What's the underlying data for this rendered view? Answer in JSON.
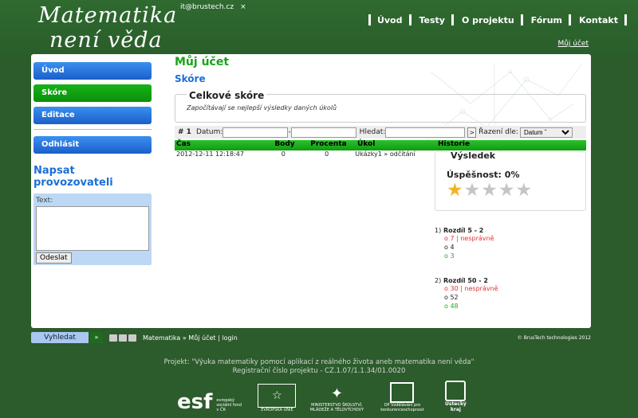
{
  "header": {
    "logo_line1": "Matematika",
    "logo_line2": "není věda",
    "email": "it@brustech.cz",
    "close": "×",
    "nav": [
      "Úvod",
      "Testy",
      "O projektu",
      "Fórum",
      "Kontakt"
    ],
    "my_account": "Můj účet"
  },
  "sidebar": {
    "items": [
      {
        "label": "Úvod",
        "active": false
      },
      {
        "label": "Skóre",
        "active": true
      },
      {
        "label": "Editace",
        "active": false
      }
    ],
    "logout": "Odhlásit",
    "feedback_title": "Napsat provozovateli",
    "text_label": "Text:",
    "send": "Odeslat"
  },
  "main": {
    "title": "Můj účet",
    "subtitle": "Skóre",
    "total_legend": "Celkové skóre",
    "total_note": "Započítávají se nejlepší výsledky daných úkolů",
    "filter": {
      "count": "# 1",
      "date_label": "Datum:",
      "dash": "-",
      "search_label": "Hledat:",
      "go": ">",
      "sort_label": "Řazení dle:",
      "sort_value": "Datum ˇ"
    },
    "columns": [
      "Čas",
      "Body",
      "Procenta",
      "Úkol",
      "Historie"
    ],
    "rows": [
      {
        "time": "2012-12-11 12:18:47",
        "points": "0",
        "percent": "0",
        "task": "Ukázky1 » odčítání"
      }
    ],
    "result": {
      "title": "Výsledek",
      "success": "Úspěšnost: 0%",
      "stars_total": 5,
      "stars_on": 1
    },
    "differences": [
      {
        "num": "1)",
        "title": "Rozdíl 5 - 2",
        "answers": [
          {
            "mark": "o",
            "text": "7",
            "suffix": " | nesprávně",
            "status": "wrong"
          },
          {
            "mark": "o",
            "text": "4",
            "suffix": "",
            "status": "neutral"
          },
          {
            "mark": "o",
            "text": "3",
            "suffix": "",
            "status": "ok"
          }
        ]
      },
      {
        "num": "2)",
        "title": "Rozdíl 50 - 2",
        "answers": [
          {
            "mark": "o",
            "text": "30",
            "suffix": " | nesprávně",
            "status": "wrong"
          },
          {
            "mark": "o",
            "text": "52",
            "suffix": "",
            "status": "neutral"
          },
          {
            "mark": "o",
            "text": "48",
            "suffix": "",
            "status": "ok"
          }
        ]
      }
    ]
  },
  "footer": {
    "search": "Vyhledat",
    "go": "»",
    "crumb_home": "Matematika",
    "crumb_sep": " » ",
    "crumb_current": "Můj účet",
    "crumb_pipe": " | ",
    "crumb_login": "login",
    "copyright": "© BrusTech technologies 2012",
    "project_line1": "Projekt: \"Výuka matematiky pomocí aplikací z reálného života aneb matematika není věda\"",
    "project_line2": "Registrační číslo projektu - CZ.1.07/1.1.34/01.0020",
    "logos": [
      "esf",
      "evropský sociální fond v ČR",
      "EVROPSKÁ UNIE",
      "MINISTERSTVO ŠKOLSTVÍ, MLÁDEŽE A TĚLOVÝCHOVY",
      "OP Vzdělávání pro konkurenceschopnost",
      "Ústecký kraj"
    ]
  },
  "colors": {
    "page_bg": "#2c5b2c",
    "nav_blue": "#1b5fc9",
    "active_green": "#0a8f0a",
    "heading_green": "#16a516",
    "heading_blue": "#1b6fd6",
    "wrong": "#dd3333",
    "ok": "#22aa22"
  }
}
